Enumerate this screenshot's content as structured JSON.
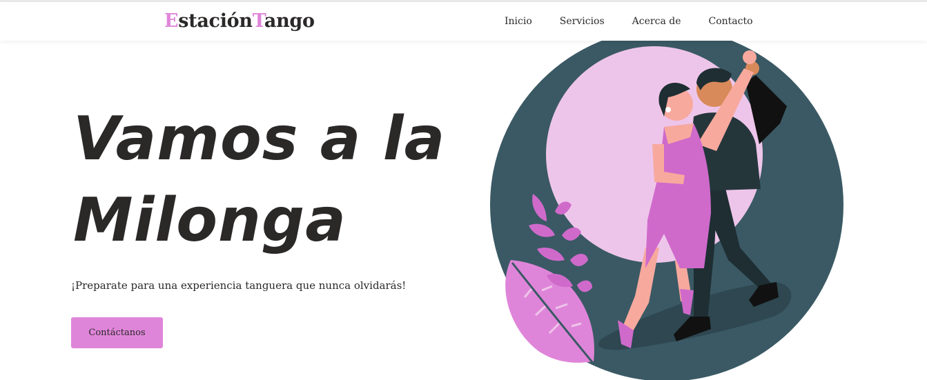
{
  "brand": {
    "letter1": "E",
    "part1": "stación",
    "letter2": "T",
    "part2": "ango"
  },
  "nav": [
    {
      "label": "Inicio"
    },
    {
      "label": "Servicios"
    },
    {
      "label": "Acerca de"
    },
    {
      "label": "Contacto"
    }
  ],
  "hero": {
    "title": "Vamos a la Milonga",
    "subtitle": "¡Preparate para una experiencia tanguera que nunca olvidarás!",
    "cta_label": "Contáctanos"
  },
  "colors": {
    "accent": "#df85d9",
    "text": "#2b2828",
    "circle": "#3a5964",
    "moon": "#eec5ea",
    "dress": "#cf6acb"
  }
}
